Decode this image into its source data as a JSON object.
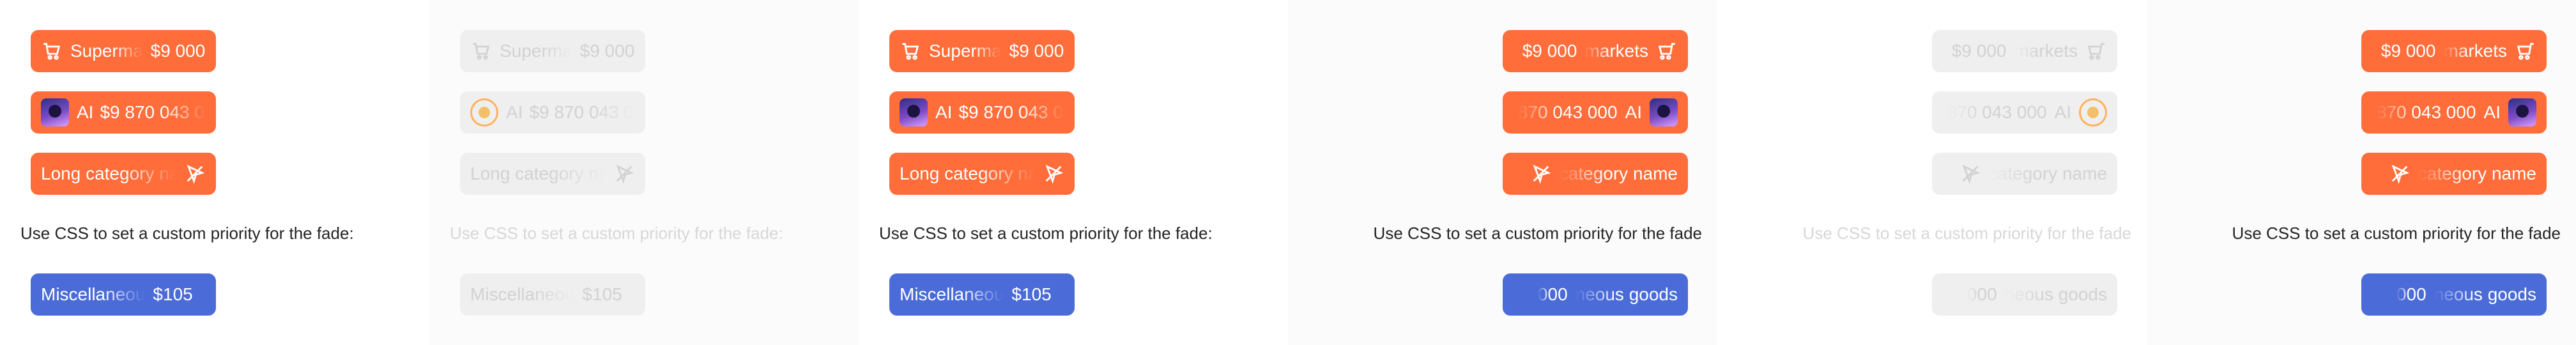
{
  "panels": [
    {
      "variant": "ltr-enabled",
      "chips": {
        "supermarkets": {
          "label": "Superma",
          "amount": "$9 000"
        },
        "ai": {
          "label": "AI",
          "amount": "$9 870 043 00"
        },
        "long_category": {
          "label": "Long category na"
        },
        "misc": {
          "label": "Miscellaneou",
          "amount": "$105"
        }
      },
      "note": "Use CSS to set a custom priority for the fade:"
    },
    {
      "variant": "ltr-disabled",
      "chips": {
        "supermarkets": {
          "label": "Superma",
          "amount": "$9 000"
        },
        "ai": {
          "label": "AI",
          "amount": "$9 870 043 00"
        },
        "long_category": {
          "label": "Long category na"
        },
        "misc": {
          "label": "Miscellaneou",
          "amount": "$105"
        }
      },
      "note": "Use CSS to set a custom priority for the fade:"
    },
    {
      "variant": "ltr-enabled",
      "chips": {
        "supermarkets": {
          "label": "Superma",
          "amount": "$9 000"
        },
        "ai": {
          "label": "AI",
          "amount": "$9 870 043 00"
        },
        "long_category": {
          "label": "Long category na"
        },
        "misc": {
          "label": "Miscellaneou",
          "amount": "$105"
        }
      },
      "note": "Use CSS to set a custom priority for the fade:"
    },
    {
      "variant": "rtl-enabled",
      "chips": {
        "supermarkets": {
          "label": "markets",
          "amount": "$9 000"
        },
        "ai": {
          "label": "AI",
          "amount": "870 043 000"
        },
        "long_category": {
          "label": "category name"
        },
        "misc": {
          "label": "neous goods",
          "amount": "000"
        }
      },
      "note": "Use CSS to set a custom priority for the fade"
    },
    {
      "variant": "rtl-disabled",
      "chips": {
        "supermarkets": {
          "label": "markets",
          "amount": "$9 000"
        },
        "ai": {
          "label": "AI",
          "amount": "870 043 000"
        },
        "long_category": {
          "label": "category name"
        },
        "misc": {
          "label": "neous goods",
          "amount": "000"
        }
      },
      "note": "Use CSS to set a custom priority for the fade"
    },
    {
      "variant": "rtl-enabled",
      "chips": {
        "supermarkets": {
          "label": "markets",
          "amount": "$9 000"
        },
        "ai": {
          "label": "AI",
          "amount": "870 043 000"
        },
        "long_category": {
          "label": "category name"
        },
        "misc": {
          "label": "neous goods",
          "amount": "000"
        }
      },
      "note": "Use CSS to set a custom priority for the fade"
    }
  ],
  "colors": {
    "orange": "#ff6d3b",
    "blue": "#4a6bd8",
    "disabled": "#efefef"
  },
  "icons": [
    "cart-icon",
    "avatar-icon",
    "ban-icon"
  ]
}
